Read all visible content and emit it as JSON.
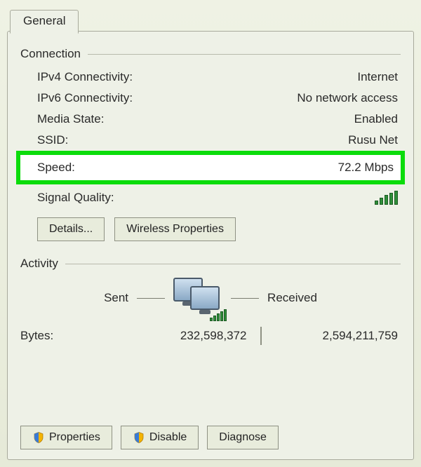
{
  "tab": {
    "general": "General"
  },
  "connection": {
    "title": "Connection",
    "ipv4_label": "IPv4 Connectivity:",
    "ipv4_value": "Internet",
    "ipv6_label": "IPv6 Connectivity:",
    "ipv6_value": "No network access",
    "media_label": "Media State:",
    "media_value": "Enabled",
    "ssid_label": "SSID:",
    "ssid_value": "Rusu Net",
    "speed_label": "Speed:",
    "speed_value": "72.2 Mbps",
    "signal_label": "Signal Quality:"
  },
  "buttons": {
    "details": "Details...",
    "wireless_props": "Wireless Properties",
    "properties": "Properties",
    "disable": "Disable",
    "diagnose": "Diagnose"
  },
  "activity": {
    "title": "Activity",
    "sent_label": "Sent",
    "received_label": "Received",
    "bytes_label": "Bytes:",
    "bytes_sent": "232,598,372",
    "bytes_recv": "2,594,211,759"
  }
}
